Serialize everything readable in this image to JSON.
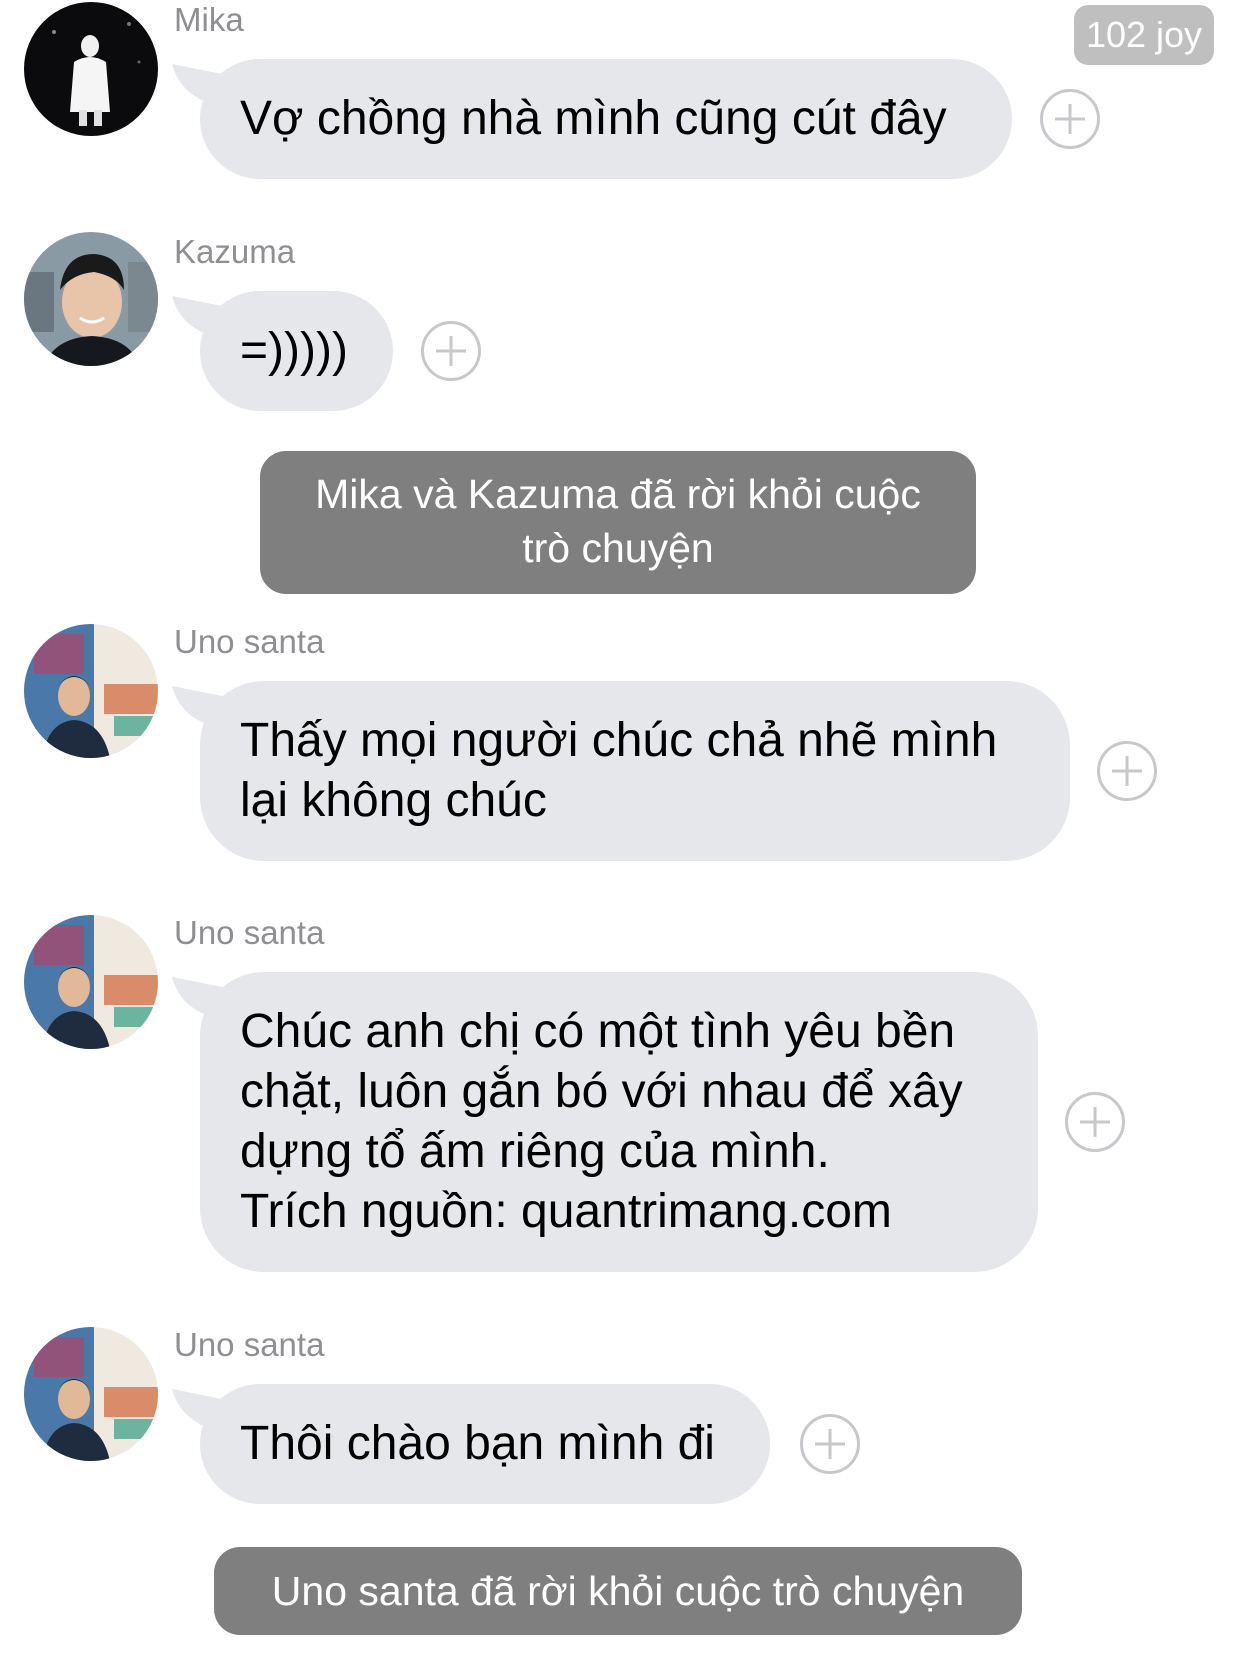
{
  "header": {
    "reaction_badge": "102 joy"
  },
  "messages": [
    {
      "sender": "Mika",
      "text": "Vợ chồng nhà mình cũng cút đây"
    },
    {
      "sender": "Kazuma",
      "text": "=)))))"
    },
    {
      "sender": "Uno santa",
      "lines": [
        "Thấy mọi người chúc chả nhẽ mình",
        "lại không chúc"
      ]
    },
    {
      "sender": "Uno santa",
      "lines": [
        "Chúc anh chị có một tình yêu bền",
        "chặt, luôn gắn bó với nhau để xây",
        "dựng tổ ấm riêng của mình.",
        "Trích nguồn: quantrimang.com"
      ]
    },
    {
      "sender": "Uno santa",
      "text": "Thôi chào bạn mình đi"
    }
  ],
  "system_messages": [
    {
      "lines": [
        "Mika và Kazuma đã rời khỏi cuộc",
        "trò chuyện"
      ]
    },
    {
      "text": "Uno santa đã rời khỏi cuộc trò chuyện"
    }
  ],
  "colors": {
    "bubble": "#e5e7ea",
    "system_bubble": "#7f7f7f",
    "sender_name": "#8e8e93",
    "badge": "#bfbfbf"
  },
  "icons": [
    "add-reaction-icon",
    "avatar-photo"
  ]
}
